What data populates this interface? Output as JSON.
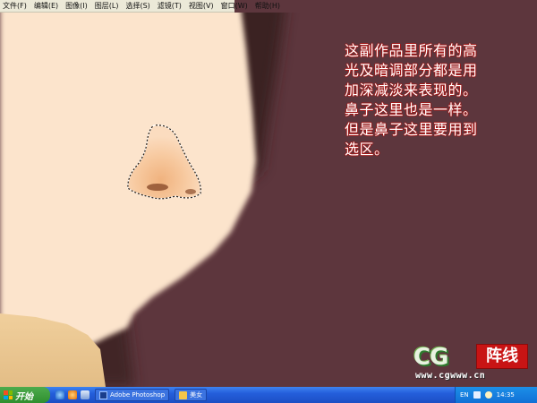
{
  "menu": {
    "items": [
      "文件(F)",
      "编辑(E)",
      "图像(I)",
      "图层(L)",
      "选择(S)",
      "滤镜(T)",
      "视图(V)",
      "窗口(W)",
      "帮助(H)"
    ]
  },
  "annotation": {
    "lines": [
      "这副作品里所有的高",
      "光及暗调部分都是用",
      "加深减淡来表现的。",
      "鼻子这里也是一样。",
      "但是鼻子这里要用到",
      "选区。"
    ]
  },
  "watermark": {
    "logo": "CG",
    "cn": "阵线",
    "url": "www.cgwww.cn"
  },
  "taskbar": {
    "start_label": "开始",
    "tasks": [
      {
        "label": "Adobe Photoshop",
        "icon": "photoshop-icon"
      },
      {
        "label": "美女",
        "icon": "folder-icon"
      }
    ],
    "tray": {
      "lang": "EN",
      "time": "14:35"
    }
  },
  "colors": {
    "background": "#5d363d",
    "skin": "#fce4cc",
    "hair": "#3b2320",
    "note_text": "#ffffff",
    "note_outline": "#a01818",
    "taskbar": "#245edb"
  }
}
